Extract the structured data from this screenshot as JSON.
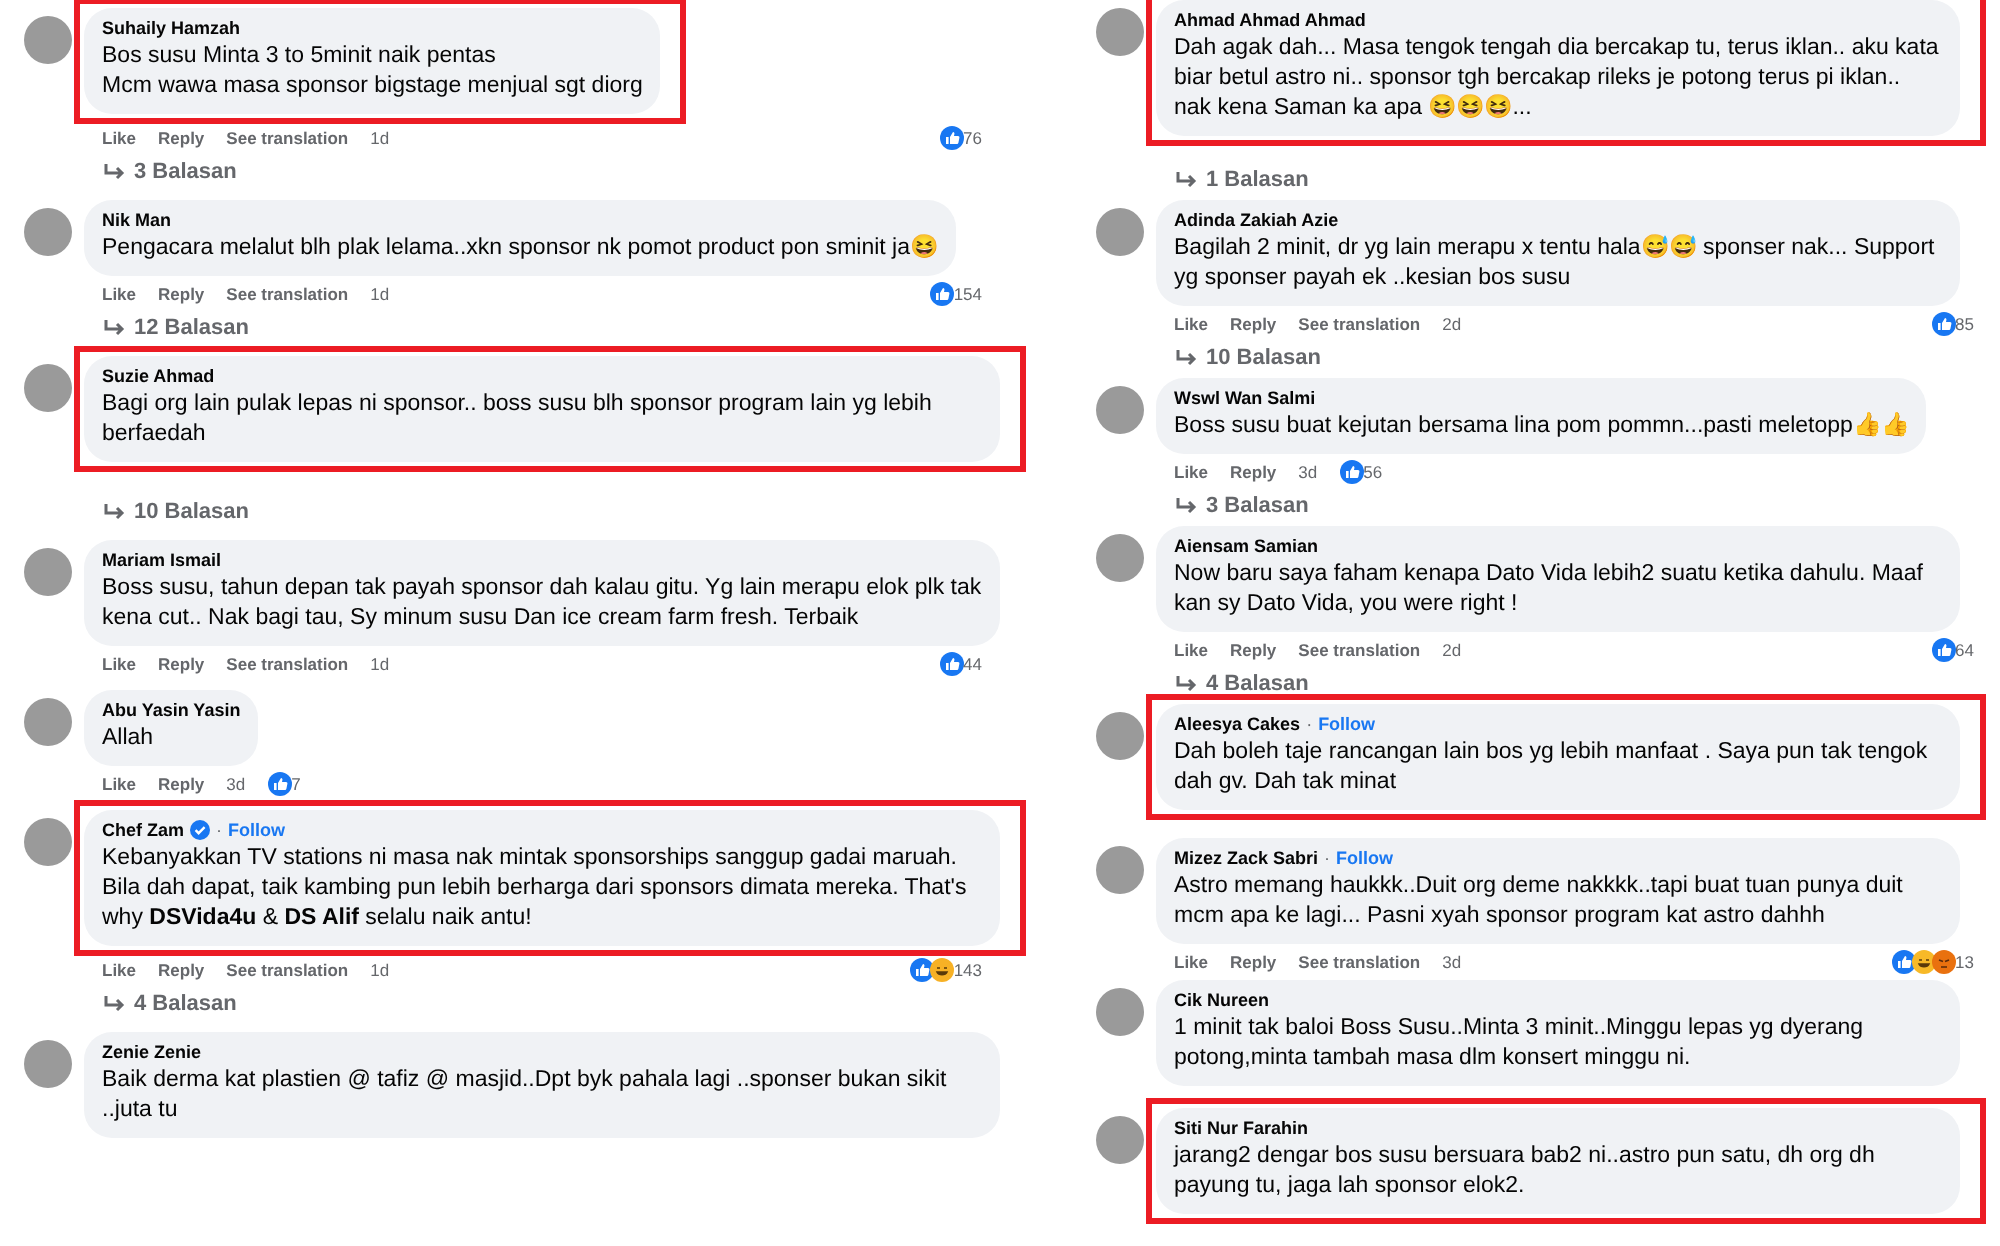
{
  "columns": [
    {
      "comments": [
        {
          "author": "Suhaily Hamzah",
          "verified": false,
          "text": "Bos susu Minta 3 to 5minit naik pentas\nMcm wawa masa sponsor bigstage menjual sgt diorg",
          "highlighted": true,
          "actions": {
            "like": "Like",
            "reply": "Reply",
            "translate": "See translation",
            "time": "1d",
            "reactions": [
              {
                "kind": "like"
              }
            ],
            "count": "76"
          },
          "replies": "3 Balasan"
        },
        {
          "author": "Nik Man",
          "verified": false,
          "text": "Pengacara melalut blh plak lelama..xkn sponsor nk pomot product pon sminit ja😆",
          "highlighted": false,
          "actions": {
            "like": "Like",
            "reply": "Reply",
            "translate": "See translation",
            "time": "1d",
            "reactions": [
              {
                "kind": "like"
              }
            ],
            "count": "154"
          },
          "replies": "12 Balasan"
        },
        {
          "author": "Suzie Ahmad",
          "verified": false,
          "text": "Bagi org lain pulak lepas ni sponsor.. boss susu blh sponsor program lain yg lebih berfaedah",
          "highlighted": true,
          "replies": "10 Balasan"
        },
        {
          "author": "Mariam Ismail",
          "verified": false,
          "text": "Boss susu, tahun depan tak payah sponsor dah kalau gitu. Yg lain merapu elok plk tak kena cut.. Nak bagi tau, Sy minum susu Dan ice cream farm fresh. Terbaik",
          "highlighted": false,
          "actions": {
            "like": "Like",
            "reply": "Reply",
            "translate": "See translation",
            "time": "1d",
            "reactions": [
              {
                "kind": "like"
              }
            ],
            "count": "44"
          }
        },
        {
          "author": "Abu Yasin Yasin",
          "verified": false,
          "text": "Allah",
          "highlighted": false,
          "actions": {
            "like": "Like",
            "reply": "Reply",
            "time": "3d",
            "reactions": [
              {
                "kind": "like"
              }
            ],
            "count": "7"
          }
        },
        {
          "author": "Chef Zam",
          "verified": true,
          "separator": "·",
          "follow": "Follow",
          "text": "Kebanyakkan TV stations ni masa nak mintak sponsorships sanggup gadai maruah. Bila dah dapat, taik kambing pun lebih berharga dari sponsors dimata mereka. That's why **DSVida4u** & **DS Alif** selalu naik antu!",
          "highlighted": true,
          "actions": {
            "like": "Like",
            "reply": "Reply",
            "translate": "See translation",
            "time": "1d",
            "reactions": [
              {
                "kind": "like"
              },
              {
                "kind": "haha"
              }
            ],
            "count": "143"
          },
          "replies": "4 Balasan"
        },
        {
          "author": "Zenie Zenie",
          "verified": false,
          "text": "Baik derma kat plastien @ tafiz @ masjid..Dpt byk pahala lagi ..sponser bukan sikit ..juta tu",
          "highlighted": false
        }
      ]
    },
    {
      "comments": [
        {
          "author": "Ahmad Ahmad Ahmad",
          "verified": false,
          "text": "Dah agak dah... Masa tengok tengah dia bercakap tu, terus iklan.. aku kata biar betul astro ni.. sponsor tgh bercakap rileks je potong terus pi iklan.. nak kena Saman ka apa 😆😆😆...",
          "highlighted": true,
          "replies": "1 Balasan"
        },
        {
          "author": "Adinda Zakiah Azie",
          "verified": false,
          "text": "Bagilah 2 minit, dr yg lain merapu x tentu hala😅😅 sponser nak... Support yg sponser payah ek ..kesian bos susu",
          "highlighted": false,
          "actions": {
            "like": "Like",
            "reply": "Reply",
            "translate": "See translation",
            "time": "2d",
            "reactions": [
              {
                "kind": "like"
              }
            ],
            "count": "85"
          },
          "replies": "10 Balasan"
        },
        {
          "author": "Wswl Wan Salmi",
          "verified": false,
          "text": "Boss susu buat kejutan bersama lina pom pommn...pasti meletopp👍👍",
          "highlighted": false,
          "actions": {
            "like": "Like",
            "reply": "Reply",
            "time": "3d",
            "reactions": [
              {
                "kind": "like"
              }
            ],
            "count": "56"
          },
          "replies": "3 Balasan"
        },
        {
          "author": "Aiensam Samian",
          "verified": false,
          "text": "Now baru saya faham kenapa Dato Vida lebih2 suatu ketika dahulu. Maaf kan sy Dato Vida, you were right !",
          "highlighted": false,
          "actions": {
            "like": "Like",
            "reply": "Reply",
            "translate": "See translation",
            "time": "2d",
            "reactions": [
              {
                "kind": "like"
              }
            ],
            "count": "64"
          },
          "replies": "4 Balasan"
        },
        {
          "author": "Aleesya Cakes",
          "verified": false,
          "separator": "·",
          "follow": "Follow",
          "text": "Dah boleh taje rancangan lain bos yg lebih manfaat . Saya pun tak tengok dah gv. Dah tak minat",
          "highlighted": true
        },
        {
          "author": "Mizez Zack Sabri",
          "verified": false,
          "separator": "·",
          "follow": "Follow",
          "text": "Astro memang haukkk..Duit org deme nakkkk..tapi buat tuan punya duit mcm apa ke lagi... Pasni xyah sponsor program kat astro dahhh",
          "highlighted": false,
          "actions": {
            "like": "Like",
            "reply": "Reply",
            "translate": "See translation",
            "time": "3d",
            "reactions": [
              {
                "kind": "like"
              },
              {
                "kind": "care"
              },
              {
                "kind": "angry"
              }
            ],
            "count": "13"
          }
        },
        {
          "author": "Cik Nureen",
          "verified": false,
          "text": "1 minit tak baloi Boss Susu..Minta 3 minit..Minggu lepas yg dyerang potong,minta tambah masa dlm konsert minggu ni.",
          "highlighted": false
        },
        {
          "author": "Siti Nur Farahin",
          "verified": false,
          "text": "jarang2 dengar bos susu bersuara bab2 ni..astro pun satu, dh org dh payung tu, jaga lah sponsor elok2.",
          "highlighted": true
        }
      ]
    }
  ]
}
